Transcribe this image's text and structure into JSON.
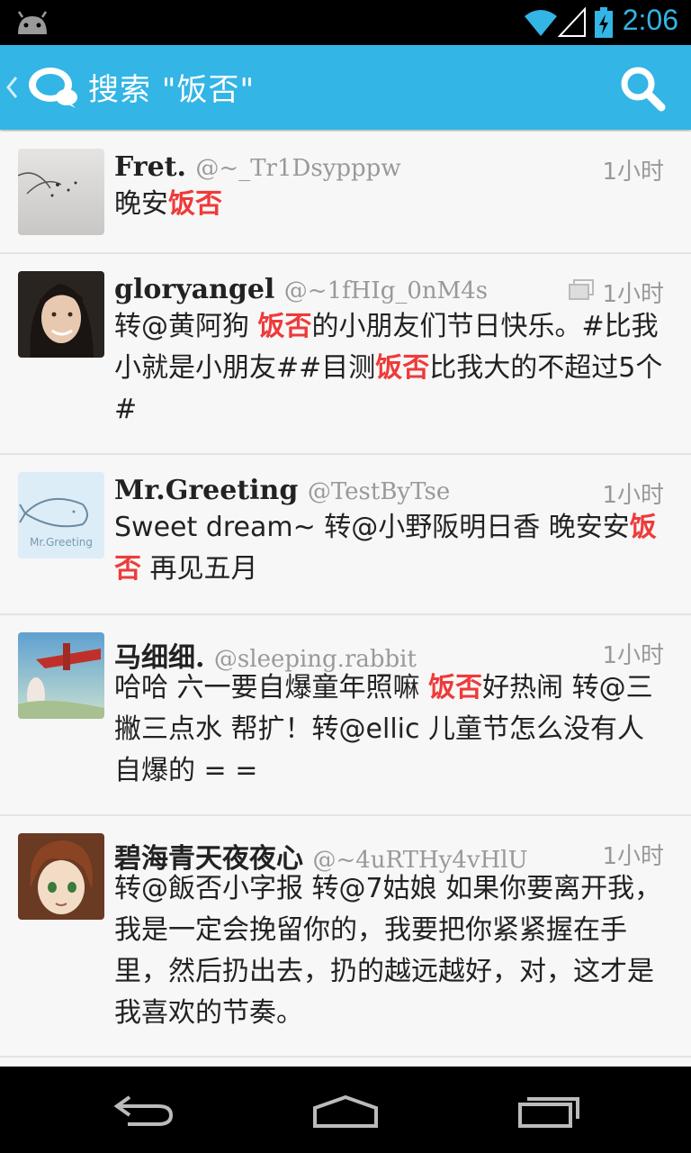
{
  "status_bar": {
    "time": "2:06"
  },
  "action_bar": {
    "title": "搜索 \"饭否\""
  },
  "search": {
    "term": "饭否"
  },
  "posts": [
    {
      "name": "Fret.",
      "handle": "@~_Tr1Dsypppw",
      "time": "1小时",
      "body_segments": [
        {
          "text": "晚安",
          "highlight": false
        },
        {
          "text": "饭否",
          "highlight": true
        }
      ]
    },
    {
      "name": "gloryangel",
      "handle": "@~1fHIg_0nM4s",
      "time": "1小时",
      "has_photo": true,
      "body_segments": [
        {
          "text": "转@黄阿狗 ",
          "highlight": false
        },
        {
          "text": "饭否",
          "highlight": true
        },
        {
          "text": "的小朋友们节日快乐。#比我小就是小朋友##目测",
          "highlight": false
        },
        {
          "text": "饭否",
          "highlight": true
        },
        {
          "text": "比我大的不超过5个#",
          "highlight": false
        }
      ]
    },
    {
      "name": "Mr.Greeting",
      "handle": "@TestByTse",
      "time": "1小时",
      "avatar_text": "Mr.Greeting",
      "body_segments": [
        {
          "text": "Sweet dream~ 转@小野阪明日香 晚安安",
          "highlight": false
        },
        {
          "text": "饭否",
          "highlight": true
        },
        {
          "text": " 再见五月",
          "highlight": false
        }
      ]
    },
    {
      "name": "马细细.",
      "handle": "@sleeping.rabbit",
      "time": "1小时",
      "body_segments": [
        {
          "text": "哈哈 六一要自爆童年照嘛 ",
          "highlight": false
        },
        {
          "text": "饭否",
          "highlight": true
        },
        {
          "text": "好热闹 转@三撇三点水 帮扩！转@ellic 儿童节怎么没有人自爆的 = =",
          "highlight": false
        }
      ]
    },
    {
      "name": "碧海青天夜夜心",
      "handle": "@~4uRTHy4vHlU",
      "time": "1小时",
      "body_segments": [
        {
          "text": "转@飯否小字报 转@7姑娘 如果你要离开我，我是一定会挽留你的，我要把你紧紧握在手里，然后扔出去，扔的越远越好，对，这才是我喜欢的节奏。",
          "highlight": false
        }
      ]
    }
  ],
  "colors": {
    "accent": "#33b5e5",
    "highlight": "#ef3a3a"
  },
  "nav_bar": {
    "icons": [
      "back-icon",
      "home-icon",
      "recent-apps-icon"
    ]
  }
}
